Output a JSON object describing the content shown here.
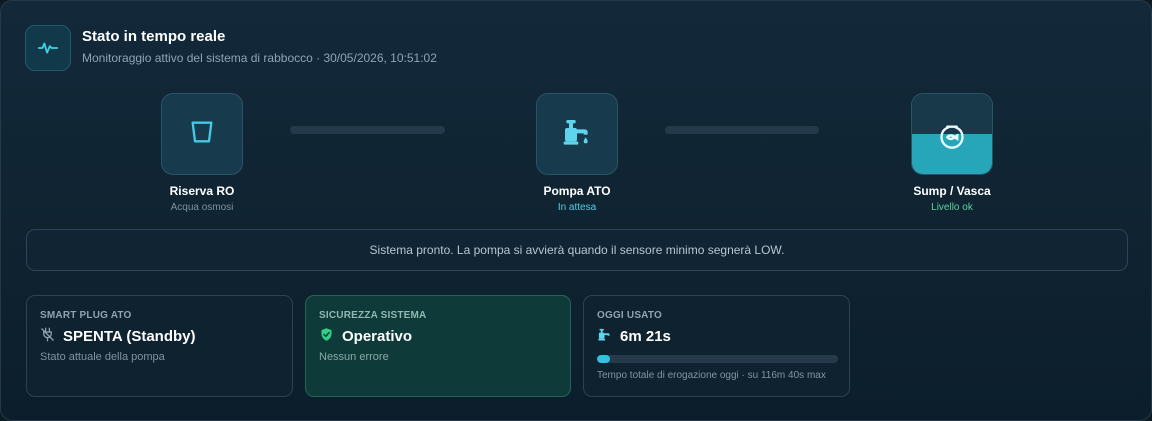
{
  "header": {
    "icon": "activity-pulse-icon",
    "title": "Stato in tempo reale",
    "subtitle": "Monitoraggio attivo del sistema di rabbocco · 30/05/2026, 10:51:02"
  },
  "flow": {
    "source": {
      "icon": "cup-icon",
      "label": "Riserva RO",
      "status": "Acqua osmosi"
    },
    "pump": {
      "icon": "pump-icon",
      "label": "Pompa ATO",
      "status": "In attesa",
      "status_color": "#4fd0ea"
    },
    "tank": {
      "icon": "fishbowl-icon",
      "label": "Sump / Vasca",
      "status": "Livello ok",
      "status_color": "#5fd39b",
      "water_level_fraction": 0.5
    }
  },
  "banner": {
    "message": "Sistema pronto. La pompa si avvierà quando il sensore minimo segnerà LOW."
  },
  "cards": {
    "plug": {
      "title": "SMART PLUG ATO",
      "icon": "plug-off-icon",
      "value": "SPENTA (Standby)",
      "subtitle": "Stato attuale della pompa"
    },
    "safety": {
      "title": "SICUREZZA SISTEMA",
      "icon": "shield-check-icon",
      "value": "Operativo",
      "subtitle": "Nessun errore",
      "accent": "#2fd08a"
    },
    "usage": {
      "title": "OGGI USATO",
      "icon": "pump-icon",
      "value": "6m 21s",
      "progress_fraction": 0.054,
      "caption": "Tempo totale di erogazione oggi · su 116m 40s max"
    }
  },
  "colors": {
    "accent": "#2ec4e0",
    "success": "#2fd08a",
    "background": "#0f2331"
  }
}
